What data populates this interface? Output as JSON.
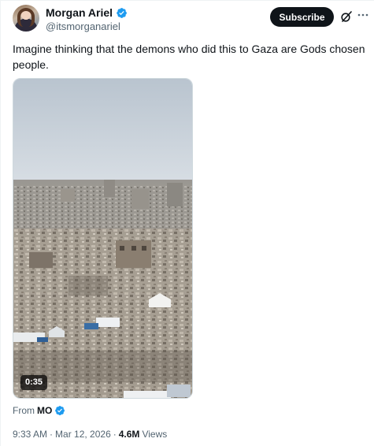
{
  "author": {
    "display_name": "Morgan Ariel",
    "handle": "@itsmorganariel",
    "verified": true
  },
  "actions": {
    "subscribe_label": "Subscribe",
    "grok_icon": "grok-slash-icon",
    "more_icon": "more-dots-icon"
  },
  "tweet": {
    "text": "Imagine thinking that the demons who did this to Gaza are Gods chosen people."
  },
  "media": {
    "type": "video",
    "duration": "0:35"
  },
  "source": {
    "from_label": "From",
    "name": "MO",
    "verified": true
  },
  "meta": {
    "time": "9:33 AM",
    "separator": "·",
    "date": "Mar 12, 2026",
    "separator2": "·",
    "views_count": "4.6M",
    "views_label": "Views"
  },
  "colors": {
    "verified_blue": "#1d9bf0",
    "text_primary": "#0f1419",
    "text_secondary": "#536471",
    "button_dark": "#0f1419"
  }
}
